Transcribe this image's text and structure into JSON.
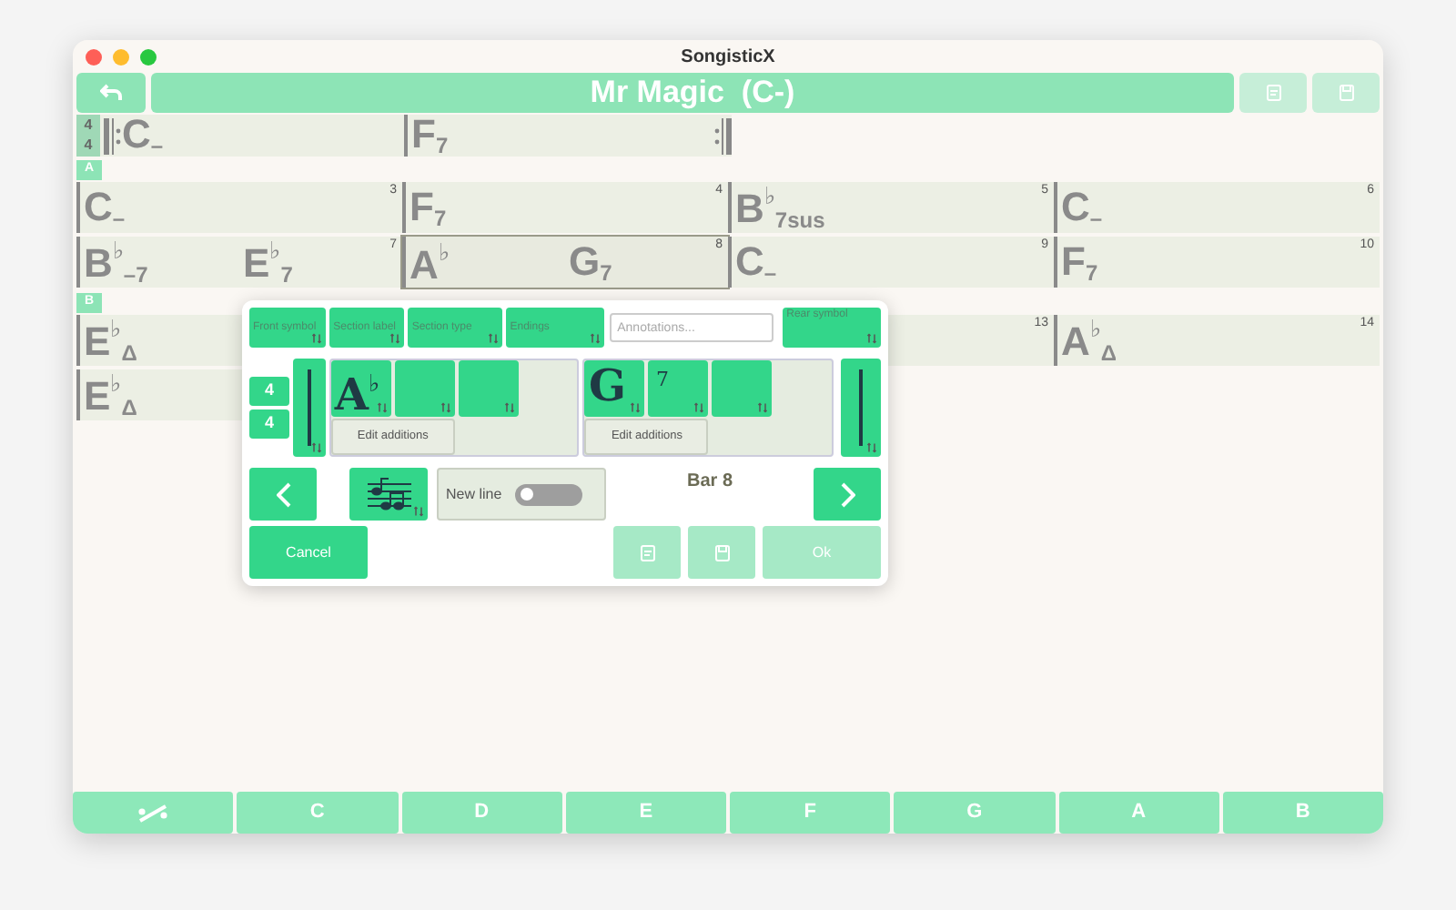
{
  "window": {
    "title": "SongisticX"
  },
  "header": {
    "title": "Mr Magic  (C-)"
  },
  "intro": {
    "time_signature": [
      "4",
      "4"
    ],
    "bars": [
      {
        "repeat_start": true,
        "repeat_end": false,
        "chords": [
          {
            "root": "C",
            "suffix": "–"
          }
        ]
      },
      {
        "repeat_start": false,
        "repeat_end": true,
        "chords": [
          {
            "root": "F",
            "suffix": "7"
          }
        ]
      }
    ]
  },
  "sections": [
    {
      "label": "A",
      "rows": [
        [
          {
            "number": "3",
            "selected": false,
            "chords": [
              {
                "root": "C",
                "suffix": "–"
              }
            ]
          },
          {
            "number": "4",
            "selected": false,
            "chords": [
              {
                "root": "F",
                "suffix": "7"
              }
            ]
          },
          {
            "number": "5",
            "selected": false,
            "chords": [
              {
                "root": "B",
                "accidental": "♭",
                "suffix": "7sus"
              }
            ]
          },
          {
            "number": "6",
            "selected": false,
            "chords": [
              {
                "root": "C",
                "suffix": "–"
              }
            ]
          }
        ],
        [
          {
            "number": "7",
            "selected": false,
            "chords": [
              {
                "root": "B",
                "accidental": "♭",
                "suffix": "–7"
              },
              {
                "root": "E",
                "accidental": "♭",
                "suffix": "7"
              }
            ]
          },
          {
            "number": "8",
            "selected": true,
            "chords": [
              {
                "root": "A",
                "accidental": "♭"
              },
              {
                "root": "G",
                "suffix": "7"
              }
            ]
          },
          {
            "number": "9",
            "selected": false,
            "chords": [
              {
                "root": "C",
                "suffix": "–"
              }
            ]
          },
          {
            "number": "10",
            "selected": false,
            "chords": [
              {
                "root": "F",
                "suffix": "7"
              }
            ]
          }
        ]
      ]
    },
    {
      "label": "B",
      "rows": [
        [
          {
            "selected": false,
            "chords": [
              {
                "root": "E",
                "accidental": "♭",
                "suffix": "Δ"
              }
            ]
          },
          {},
          {
            "number": "13",
            "selected": false
          },
          {
            "number": "14",
            "selected": false,
            "chords": [
              {
                "root": "A",
                "accidental": "♭",
                "suffix": "Δ"
              }
            ]
          }
        ],
        [
          {
            "selected": false,
            "chords": [
              {
                "root": "E",
                "accidental": "♭",
                "suffix": "Δ"
              }
            ]
          }
        ]
      ]
    }
  ],
  "editor": {
    "top_buttons": [
      "Front symbol",
      "Section label",
      "Section type",
      "Endings"
    ],
    "annotations": {
      "placeholder": "Annotations..."
    },
    "rear_button": "Rear symbol",
    "time_signature": [
      "4",
      "4"
    ],
    "beats": [
      {
        "slots": [
          {
            "kind": "root",
            "text": "A",
            "accidental": "♭"
          },
          {
            "kind": "quality"
          },
          {
            "kind": "extension"
          }
        ],
        "edit": "Edit additions"
      },
      {
        "slots": [
          {
            "kind": "root",
            "text": "G"
          },
          {
            "kind": "quality",
            "text": "7"
          },
          {
            "kind": "extension"
          }
        ],
        "edit": "Edit additions"
      }
    ],
    "new_line": {
      "label": "New line",
      "on": false
    },
    "bar_label": "Bar 8",
    "cancel": "Cancel",
    "ok": {
      "label": "Ok",
      "disabled": true
    }
  },
  "keys": [
    "C",
    "D",
    "E",
    "F",
    "G",
    "A",
    "B"
  ]
}
